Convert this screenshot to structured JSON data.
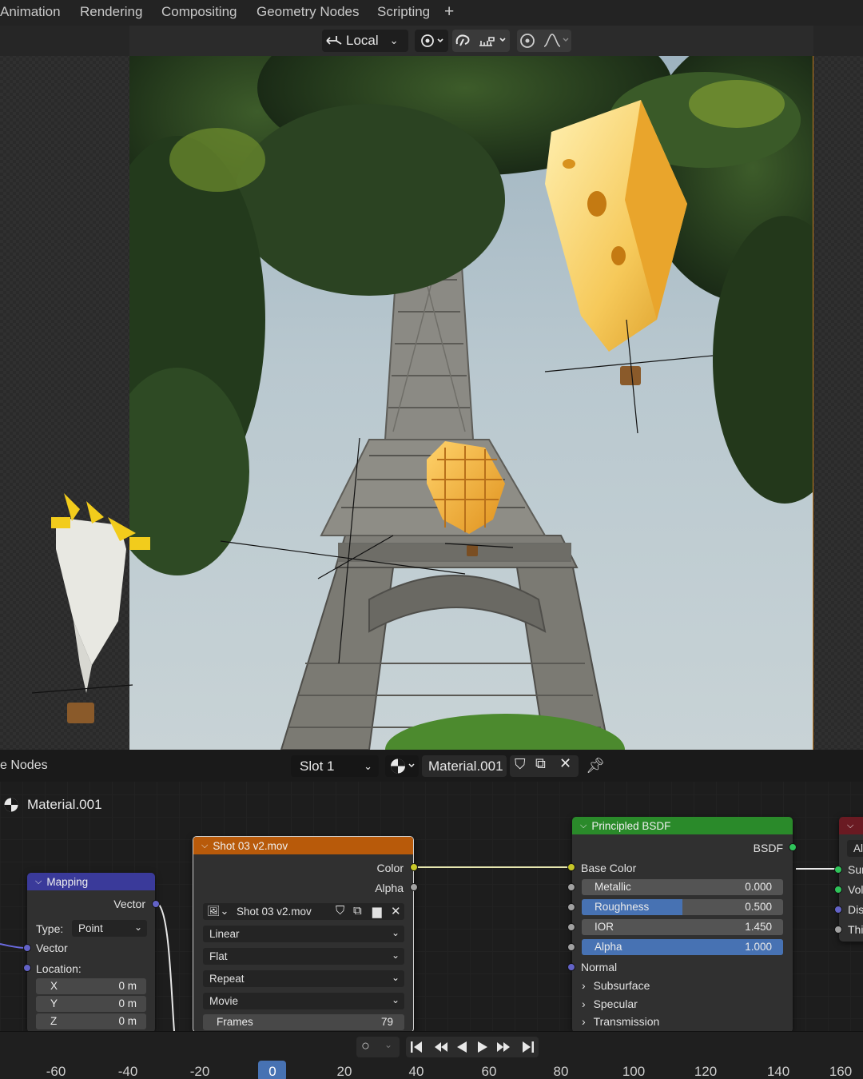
{
  "workspace_tabs": [
    "Animation",
    "Rendering",
    "Compositing",
    "Geometry Nodes",
    "Scripting"
  ],
  "viewport": {
    "transform_orientation": "Local"
  },
  "node_editor": {
    "editor_title": "e Nodes",
    "slot": "Slot 1",
    "material": "Material.001",
    "breadcrumb_material": "Material.001"
  },
  "mapping_node": {
    "title": "Mapping",
    "output_vector": "Vector",
    "type_label": "Type:",
    "type_value": "Point",
    "input_vector": "Vector",
    "location_label": "Location:",
    "x_label": "X",
    "x_value": "0 m",
    "y_label": "Y",
    "y_value": "0 m",
    "z_label": "Z",
    "z_value": "0 m"
  },
  "image_node": {
    "title": "Shot 03 v2.mov",
    "out_color": "Color",
    "out_alpha": "Alpha",
    "image_name": "Shot 03 v2.mov",
    "interpolation": "Linear",
    "projection": "Flat",
    "extension": "Repeat",
    "source": "Movie",
    "frames_label": "Frames",
    "frames_value": "79"
  },
  "bsdf_node": {
    "title": "Principled BSDF",
    "out_bsdf": "BSDF",
    "base_color": "Base Color",
    "metallic_label": "Metallic",
    "metallic_value": "0.000",
    "metallic": 0.0,
    "roughness_label": "Roughness",
    "roughness_value": "0.500",
    "roughness": 0.5,
    "ior_label": "IOR",
    "ior_value": "1.450",
    "alpha_label": "Alpha",
    "alpha_value": "1.000",
    "alpha": 1.0,
    "normal": "Normal",
    "subsurface": "Subsurface",
    "specular": "Specular",
    "transmission": "Transmission"
  },
  "output_node": {
    "row1": "Al",
    "row2": "Sur",
    "row3": "Vol",
    "row4": "Dis",
    "row5": "Thi"
  },
  "timeline": {
    "current_frame": "0",
    "ticks": [
      "-60",
      "-40",
      "-20",
      "20",
      "40",
      "60",
      "80",
      "100",
      "120",
      "140",
      "160"
    ]
  },
  "colors": {
    "mapping_header": "#3a3a9a",
    "image_header": "#b85a0a",
    "bsdf_header": "#2a8a2a",
    "output_header": "#6a1a22",
    "accent_blue": "#4772b3"
  }
}
